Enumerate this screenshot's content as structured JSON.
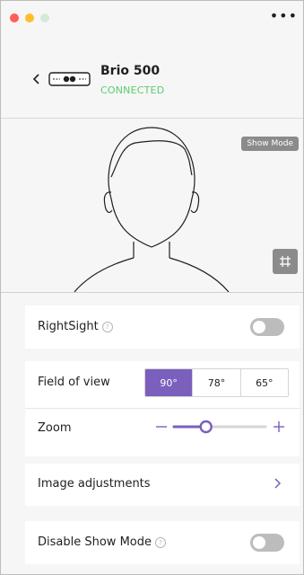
{
  "window": {
    "more_icon": "more-horizontal-icon"
  },
  "device": {
    "name": "Brio 500",
    "status": "CONNECTED",
    "status_color": "#5ecb6f"
  },
  "preview": {
    "show_mode_label": "Show Mode"
  },
  "rightsight": {
    "label": "RightSight",
    "enabled": false
  },
  "field_of_view": {
    "label": "Field of view",
    "options": [
      "90°",
      "78°",
      "65°"
    ],
    "selected": "90°"
  },
  "zoom": {
    "label": "Zoom",
    "level": 0.35
  },
  "image_adjustments": {
    "label": "Image adjustments"
  },
  "disable_show_mode": {
    "label": "Disable Show Mode",
    "enabled": false
  },
  "colors": {
    "accent": "#7b5fbd",
    "toggle_off": "#bcbcbc"
  }
}
